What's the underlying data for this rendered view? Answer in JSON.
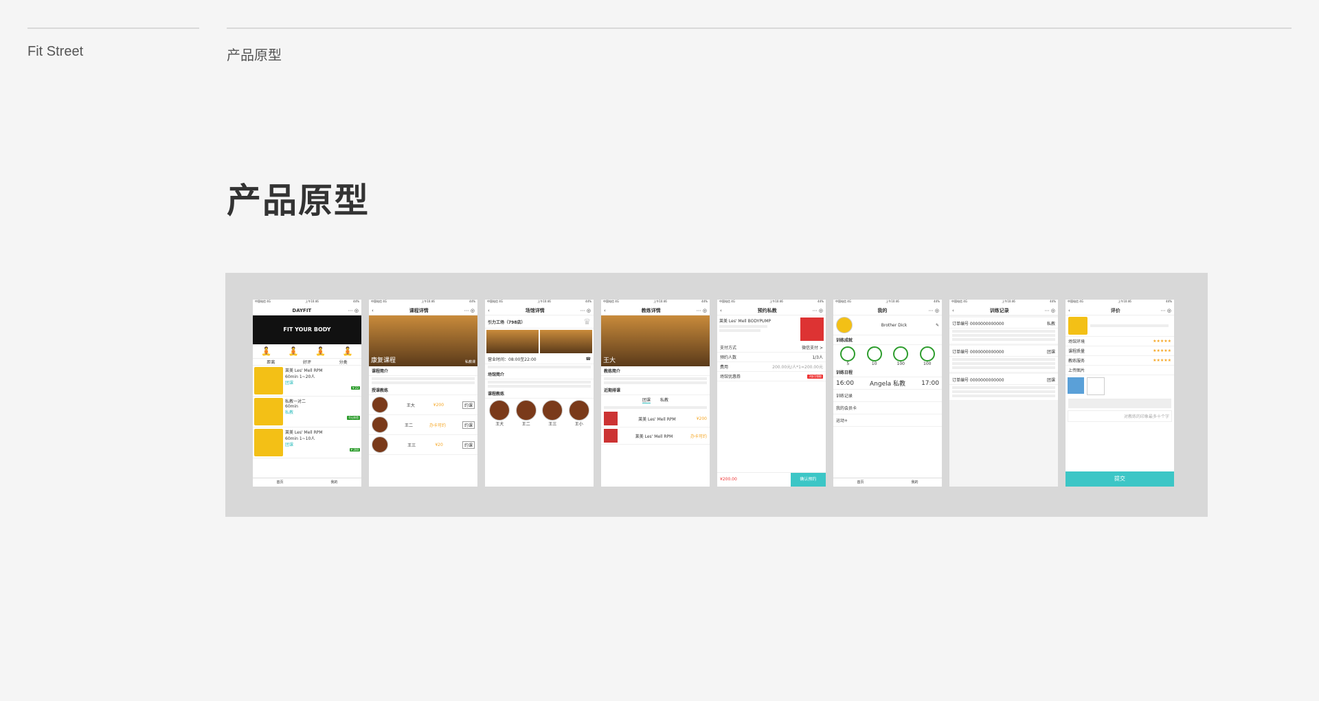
{
  "header": {
    "brand": "Fit Street",
    "section": "产品原型",
    "title": "产品原型"
  },
  "phones": {
    "status_time": "上午10:46",
    "status_carrier": "中国电信 4G",
    "status_battery": "44%",
    "home": {
      "title": "DAYFIT",
      "banner": "FIT YOUR BODY",
      "tabs": [
        "距离",
        "好评",
        "分类"
      ],
      "items": [
        {
          "name": "莱美 Les' Mell RPM",
          "tag": "团课",
          "info": "60min 1~20人",
          "price": "¥ 22"
        },
        {
          "name": "私教一对二",
          "tag": "私教",
          "info": "60min",
          "price": "0元体验"
        },
        {
          "name": "莱美 Les' Mell RPM",
          "tag": "团课",
          "info": "60min 1~10人",
          "price": "¥ 200"
        }
      ],
      "bottom_tabs": [
        "首页",
        "我的"
      ]
    },
    "course": {
      "title": "课程详情",
      "hero_text": "康复课程",
      "hero_tag": "私教课",
      "section_intro": "课程简介",
      "section_coaches": "授课教练",
      "coaches": [
        {
          "name": "王大",
          "price": "¥200",
          "btn": "约课"
        },
        {
          "name": "王二",
          "price": "办卡可约",
          "btn": "约课"
        },
        {
          "name": "王三",
          "price": "¥20",
          "btn": "约课"
        }
      ]
    },
    "venue": {
      "title": "场馆详情",
      "name": "引力工场（798店）",
      "hours": "营业时间：08:00至22:00",
      "section_intro": "场馆简介",
      "section_coaches": "课程教练",
      "coach_names": [
        "王大",
        "王二",
        "王三",
        "王小"
      ]
    },
    "coach": {
      "title": "教练详情",
      "hero_name": "王大",
      "section_intro": "教练简介",
      "section_schedule": "近期排课",
      "tabs": [
        "团课",
        "私教"
      ],
      "items": [
        {
          "name": "莱美 Les' Mell RPM",
          "price": "¥200",
          "btn": "约课"
        },
        {
          "name": "莱美 Les' Mell RPM",
          "price": "办卡可约",
          "btn": "约课"
        }
      ]
    },
    "booking": {
      "title": "预约私教",
      "course": "莱美 Les' Mell BODYPUMP",
      "rows": [
        {
          "label": "支付方式",
          "value": "微信支付 >"
        },
        {
          "label": "预约人数",
          "value": "1/3人"
        },
        {
          "label": "费用",
          "value": "200.00元/人*1=200.00元"
        },
        {
          "label": "场馆优惠券",
          "value": "3张可领取"
        }
      ],
      "total": "¥200.00",
      "confirm": "确认预约"
    },
    "mine": {
      "title": "我的",
      "user": "Brother Dick",
      "section_result": "训练成就",
      "stats": [
        "5",
        "10",
        "100",
        "100"
      ],
      "section_schedule": "训练日程",
      "start": "16:00",
      "coach": "Angela 私教",
      "end": "17:00",
      "menu": [
        "训练记录",
        "我的会员卡",
        "运动+"
      ],
      "bottom_tabs": [
        "首页",
        "我的"
      ]
    },
    "records": {
      "title": "训练记录",
      "orders": [
        {
          "no": "订单编号 0000000000000",
          "type": "私教"
        },
        {
          "no": "订单编号 0000000000000",
          "type": "团课"
        },
        {
          "no": "订单编号 0000000000000",
          "type": "团课"
        }
      ]
    },
    "review": {
      "title": "评价",
      "rows": [
        "场馆环境",
        "课程质量",
        "教练服务"
      ],
      "section_photos": "上传图片",
      "placeholder": "对教练的印象最多十个字",
      "submit": "提交"
    }
  }
}
